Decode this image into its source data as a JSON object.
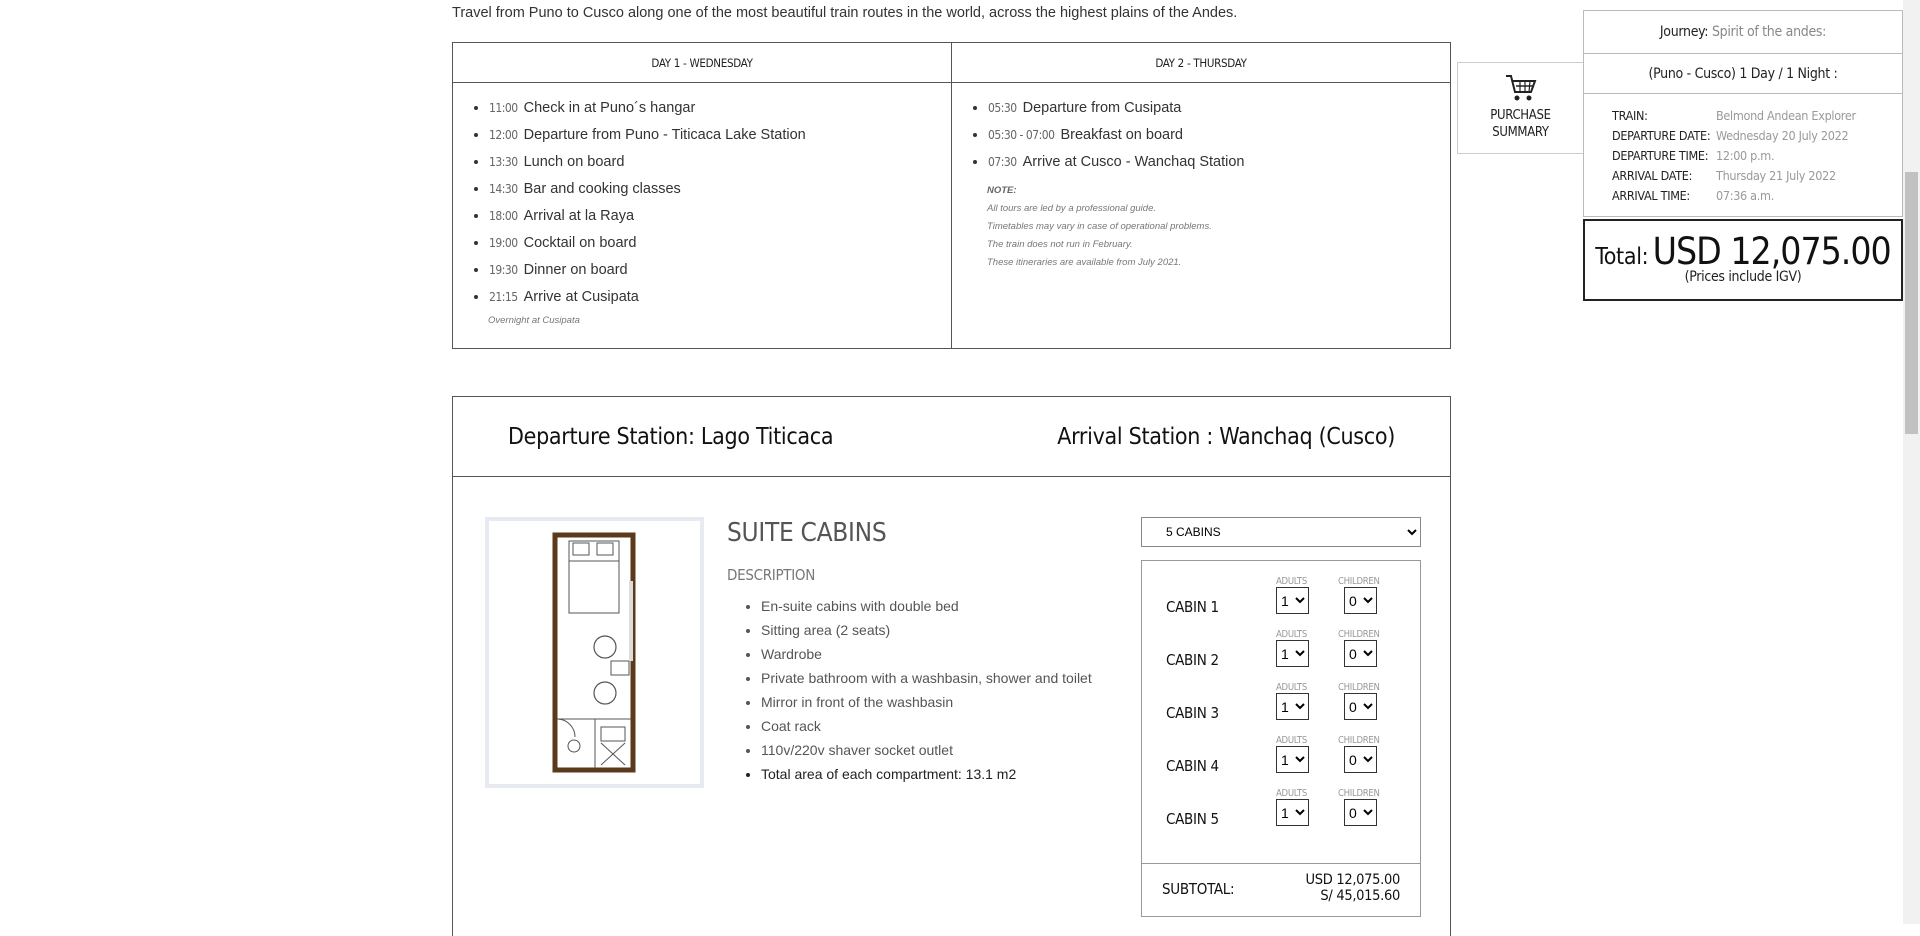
{
  "intro": "Travel from Puno to Cusco along one of the most beautiful train routes in the world, across the highest plains of the Andes.",
  "itinerary": {
    "day1": {
      "title": "DAY 1 - WEDNESDAY",
      "items": [
        {
          "time": "11:00",
          "text": "Check in at Puno´s hangar"
        },
        {
          "time": "12:00",
          "text": "Departure from Puno - Titicaca Lake Station"
        },
        {
          "time": "13:30",
          "text": "Lunch on board"
        },
        {
          "time": "14:30",
          "text": "Bar and cooking classes"
        },
        {
          "time": "18:00",
          "text": "Arrival at la Raya"
        },
        {
          "time": "19:00",
          "text": "Cocktail on board"
        },
        {
          "time": "19:30",
          "text": "Dinner on board"
        },
        {
          "time": "21:15",
          "text": "Arrive at Cusipata"
        }
      ],
      "footnote": "Overnight at Cusipata"
    },
    "day2": {
      "title": "DAY 2 - THURSDAY",
      "items": [
        {
          "time": "05:30",
          "text": "Departure from Cusipata"
        },
        {
          "time": "05:30 - 07:00",
          "text": "Breakfast on board"
        },
        {
          "time": "07:30",
          "text": "Arrive at Cusco - Wanchaq Station"
        }
      ],
      "note_title": "NOTE:",
      "notes": [
        "All tours are led by a professional guide.",
        "Timetables may vary in case of operational problems.",
        "The train does not run in February.",
        "These itineraries are available from July 2021."
      ]
    }
  },
  "purchase_summary": {
    "line1": "PURCHASE",
    "line2": "SUMMARY"
  },
  "summary": {
    "journey_label": "Journey:",
    "journey_value": "Spirit of the andes:",
    "route": "(Puno - Cusco) 1 Day / 1 Night :",
    "details": [
      {
        "label": "TRAIN:",
        "value": "Belmond Andean Explorer"
      },
      {
        "label": "DEPARTURE DATE:",
        "value": "Wednesday 20 July 2022"
      },
      {
        "label": "DEPARTURE TIME:",
        "value": "12:00 p.m."
      },
      {
        "label": "ARRIVAL DATE:",
        "value": "Thursday 21 July 2022"
      },
      {
        "label": "ARRIVAL TIME:",
        "value": "07:36 a.m."
      }
    ],
    "total_label": "Total:",
    "total_value": "USD 12,075.00",
    "igv_note": "(Prices include IGV)"
  },
  "stations": {
    "departure": "Departure Station: Lago Titicaca",
    "arrival": "Arrival Station : Wanchaq (Cusco)"
  },
  "cabin": {
    "title": "SUITE CABINS",
    "description_title": "DESCRIPTION",
    "features": [
      "En-suite cabins with double bed",
      "Sitting area (2 seats)",
      "Wardrobe",
      "Private bathroom with a washbasin, shower and toilet",
      "Mirror in front of the washbasin",
      "Coat rack",
      "110v/220v shaver socket outlet",
      "Total area of each compartment: 13.1 m2"
    ],
    "cabin_count": "5 CABINS",
    "adults_label": "ADULTS",
    "children_label": "CHILDREN",
    "cabins": [
      {
        "name": "CABIN 1",
        "adults": "1",
        "children": "0"
      },
      {
        "name": "CABIN 2",
        "adults": "1",
        "children": "0"
      },
      {
        "name": "CABIN 3",
        "adults": "1",
        "children": "0"
      },
      {
        "name": "CABIN 4",
        "adults": "1",
        "children": "0"
      },
      {
        "name": "CABIN 5",
        "adults": "1",
        "children": "0"
      }
    ],
    "subtotal_label": "SUBTOTAL:",
    "subtotal_usd": "USD 12,075.00",
    "subtotal_pen": "S/ 45,015.60"
  }
}
